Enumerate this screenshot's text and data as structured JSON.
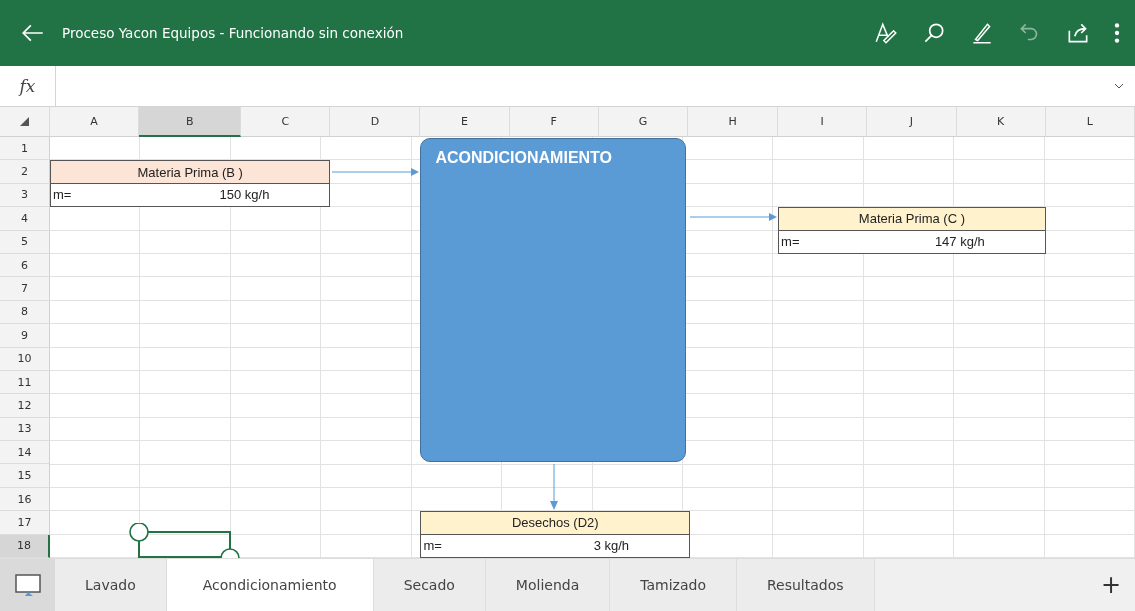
{
  "window": {
    "title": "Proceso Yacon Equipos - Funcionando sin conexión"
  },
  "formula_bar": {
    "label": "fx"
  },
  "columns": [
    {
      "label": "A",
      "selected": false
    },
    {
      "label": "B",
      "selected": true
    },
    {
      "label": "C",
      "selected": false
    },
    {
      "label": "D",
      "selected": false
    },
    {
      "label": "E",
      "selected": false
    },
    {
      "label": "F",
      "selected": false
    },
    {
      "label": "G",
      "selected": false
    },
    {
      "label": "H",
      "selected": false
    },
    {
      "label": "I",
      "selected": false
    },
    {
      "label": "J",
      "selected": false
    },
    {
      "label": "K",
      "selected": false
    },
    {
      "label": "L",
      "selected": false
    }
  ],
  "rows": [
    {
      "label": "1",
      "selected": false
    },
    {
      "label": "2",
      "selected": false
    },
    {
      "label": "3",
      "selected": false
    },
    {
      "label": "4",
      "selected": false
    },
    {
      "label": "5",
      "selected": false
    },
    {
      "label": "6",
      "selected": false
    },
    {
      "label": "7",
      "selected": false
    },
    {
      "label": "8",
      "selected": false
    },
    {
      "label": "9",
      "selected": false
    },
    {
      "label": "10",
      "selected": false
    },
    {
      "label": "11",
      "selected": false
    },
    {
      "label": "12",
      "selected": false
    },
    {
      "label": "13",
      "selected": false
    },
    {
      "label": "14",
      "selected": false
    },
    {
      "label": "15",
      "selected": false
    },
    {
      "label": "16",
      "selected": false
    },
    {
      "label": "17",
      "selected": false
    },
    {
      "label": "18",
      "selected": true
    }
  ],
  "process": {
    "title": "ACONDICIONAMIENTO"
  },
  "streams": [
    {
      "title": "Materia Prima (B )",
      "color": "#fce4d6",
      "label": "m=",
      "value": "150 kg/h"
    },
    {
      "title": "Materia Prima (C )",
      "color": "#fff2cc",
      "label": "m=",
      "value": "147 kg/h"
    },
    {
      "title": "Desechos (D2)",
      "color": "#fff2cc",
      "label": "m=",
      "value": "3 kg/h"
    }
  ],
  "sheet_tabs": [
    {
      "label": "Lavado",
      "selected": false
    },
    {
      "label": "Acondicionamiento",
      "selected": true
    },
    {
      "label": "Secado",
      "selected": false
    },
    {
      "label": "Molienda",
      "selected": false
    },
    {
      "label": "Tamizado",
      "selected": false
    },
    {
      "label": "Resultados",
      "selected": false
    }
  ],
  "add_sheet": {
    "label": "+"
  }
}
